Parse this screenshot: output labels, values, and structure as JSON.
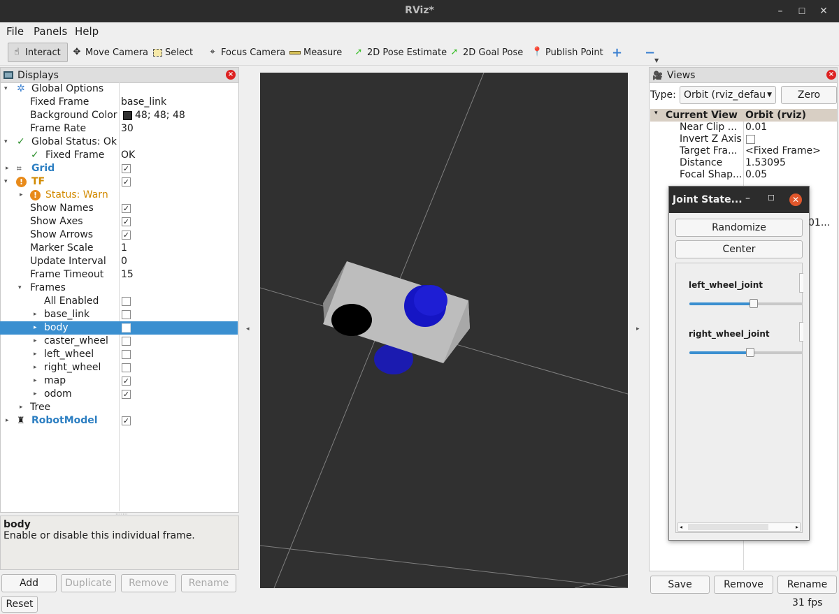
{
  "window": {
    "title": "RViz*"
  },
  "menu": {
    "file": "File",
    "panels": "Panels",
    "help": "Help"
  },
  "toolbar": {
    "interact": "Interact",
    "move_camera": "Move Camera",
    "select": "Select",
    "focus_camera": "Focus Camera",
    "measure": "Measure",
    "pose_estimate": "2D Pose Estimate",
    "goal_pose": "2D Goal Pose",
    "publish_point": "Publish Point"
  },
  "displays": {
    "title": "Displays",
    "rows": [
      {
        "label": "Global Options"
      },
      {
        "label": "Fixed Frame",
        "value": "base_link"
      },
      {
        "label": "Background Color",
        "value": "48; 48; 48"
      },
      {
        "label": "Frame Rate",
        "value": "30"
      },
      {
        "label": "Global Status: Ok"
      },
      {
        "label": "Fixed Frame",
        "value": "OK"
      },
      {
        "label": "Grid"
      },
      {
        "label": "TF"
      },
      {
        "label": "Status: Warn"
      },
      {
        "label": "Show Names"
      },
      {
        "label": "Show Axes"
      },
      {
        "label": "Show Arrows"
      },
      {
        "label": "Marker Scale",
        "value": "1"
      },
      {
        "label": "Update Interval",
        "value": "0"
      },
      {
        "label": "Frame Timeout",
        "value": "15"
      },
      {
        "label": "Frames"
      },
      {
        "label": "All Enabled"
      },
      {
        "label": "base_link"
      },
      {
        "label": "body"
      },
      {
        "label": "caster_wheel"
      },
      {
        "label": "left_wheel"
      },
      {
        "label": "right_wheel"
      },
      {
        "label": "map"
      },
      {
        "label": "odom"
      },
      {
        "label": "Tree"
      },
      {
        "label": "RobotModel"
      }
    ],
    "background_color_hex": "#303030",
    "description": {
      "title": "body",
      "text": "Enable or disable this individual frame."
    },
    "buttons": {
      "add": "Add",
      "duplicate": "Duplicate",
      "remove": "Remove",
      "rename": "Rename"
    },
    "reset": "Reset"
  },
  "views": {
    "title": "Views",
    "type_label": "Type:",
    "type_value": "Orbit (rviz_defau",
    "zero": "Zero",
    "header": {
      "name": "Current View",
      "value": "Orbit (rviz)"
    },
    "rows": [
      {
        "label": "Near Clip ...",
        "value": "0.01"
      },
      {
        "label": "Invert Z Axis",
        "value": ""
      },
      {
        "label": "Target Fra...",
        "value": "<Fixed Frame>"
      },
      {
        "label": "Distance",
        "value": "1.53095"
      },
      {
        "label": "Focal Shap...",
        "value": "0.05"
      }
    ],
    "partial_value": "01...",
    "buttons": {
      "save": "Save",
      "remove": "Remove",
      "rename": "Rename"
    },
    "fps": "31 fps"
  },
  "joint_state": {
    "title": "Joint State...",
    "randomize": "Randomize",
    "center": "Center",
    "joints": [
      {
        "name": "left_wheel_joint",
        "level": 0.57
      },
      {
        "name": "right_wheel_joint",
        "level": 0.54
      }
    ]
  },
  "colors": {
    "accent": "#3a8fd0",
    "warn": "#d28a00",
    "link_blue": "#2d7fc2"
  }
}
